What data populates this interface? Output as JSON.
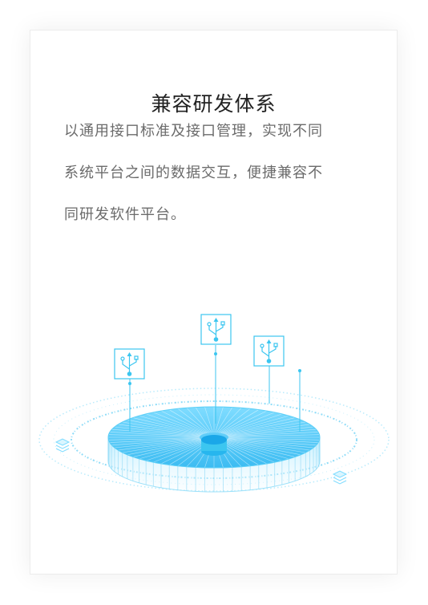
{
  "card": {
    "title": "兼容研发体系",
    "description_lines": [
      "以通用接口标准及接口管理，实现不同",
      "系统平台之间的数据交互，便捷兼容不",
      "同研发软件平台。"
    ]
  },
  "colors": {
    "accent": "#3cc6f0",
    "accent_dark": "#1aa7e8",
    "title": "#222222",
    "text": "#6b6b6b"
  },
  "icons": [
    "usb-icon",
    "usb-icon",
    "usb-icon"
  ]
}
